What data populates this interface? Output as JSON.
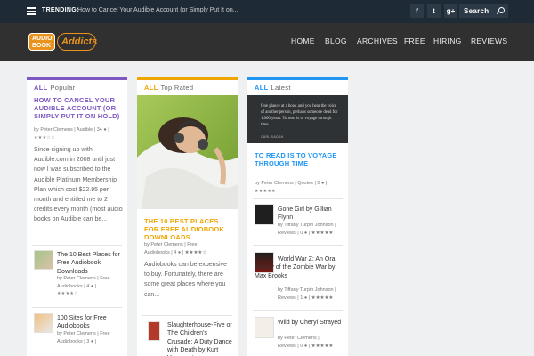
{
  "topbar": {
    "trending_label": "TRENDING:",
    "trending_text": "How to Cancel Your Audible Account (or Simply Put It on...",
    "social": [
      {
        "icon": "facebook-icon",
        "glyph": "f"
      },
      {
        "icon": "twitter-icon",
        "glyph": "t"
      },
      {
        "icon": "google-plus-icon",
        "glyph": "g+"
      }
    ],
    "search_label": "Search"
  },
  "header": {
    "logo_left_line1": "AUDIO",
    "logo_left_line2": "BOOK",
    "logo_right": "Addicts",
    "nav": [
      "HOME",
      "BLOG",
      "ARCHIVES",
      "FREE",
      "HIRING",
      "REVIEWS"
    ]
  },
  "colors": {
    "popular": "#7e57c2",
    "top_rated": "#f0a500",
    "latest": "#2196f3"
  },
  "columns": {
    "popular": {
      "all": "ALL",
      "label": "Popular",
      "feature_title": "HOW TO CANCEL YOUR AUDIBLE ACCOUNT (OR SIMPLY PUT IT ON HOLD)",
      "feature_meta": "by Peter Clemens | Audible | 34 ● |",
      "feature_stars": "★★★☆☆",
      "excerpt": "Since signing up with Audible.com in 2008 until just now I was subscribed to the Audible Platinum Membership Plan which cost $22.95 per month and entitled me to 2 credits every month (most audio books on Audible can be...",
      "items": [
        {
          "title": "The 10 Best Places for Free Audiobook Downloads",
          "meta1": "by Peter Clemens | Free",
          "meta2": "Audiobooks | 4 ● |",
          "stars": "★★★★☆"
        },
        {
          "title": "100 Sites for Free Audiobooks",
          "meta1": "by Peter Clemens | Free",
          "meta2": "Audiobooks | 3 ● |",
          "stars": ""
        }
      ]
    },
    "top_rated": {
      "all": "ALL",
      "label": "Top Rated",
      "feature_title": "THE 10 BEST PLACES FOR FREE AUDIOBOOK DOWNLOADS",
      "feature_meta1": "by Peter Clemens | Free",
      "feature_meta2": "Audiobooks | 4 ● | ★★★★☆",
      "excerpt": "Audiobooks can be expensive to buy. Fortunately, there are some great places where you can...",
      "items": [
        {
          "title": "Slaughterhouse-Five or The Children's Crusade: A Duty Dance with Death by Kurt Vonnegut"
        }
      ]
    },
    "latest": {
      "all": "ALL",
      "label": "Latest",
      "quote_text": "One glance at a book and you hear the voice of another person, perhaps someone dead for 1,000 years. To read is to voyage through time.",
      "quote_author": "CARL SAGAN",
      "feature_title": "TO READ IS TO VOYAGE THROUGH TIME",
      "feature_meta": "by Peter Clemens | Quotes | 0 ● |",
      "feature_stars": "★★★★★",
      "items": [
        {
          "title": "Gone Girl by Gillian Flynn",
          "meta1": "by Tiffany Turpin Johnson |",
          "meta2": "Reviews | 0 ● | ★★★★★",
          "thumb": "GONE GIRL"
        },
        {
          "title": "World War Z: An Oral History of the Zombie War by Max Brooks",
          "meta1": "by Tiffany Turpin Johnson |",
          "meta2": "Reviews | 1 ● | ★★★★★",
          "thumb": "WORLD WAR Z"
        },
        {
          "title": "Wild by Cheryl Strayed",
          "meta1": "by Peter Clemens |",
          "meta2": "Reviews | 0 ● | ★★★★★",
          "thumb": "wild"
        }
      ]
    }
  }
}
